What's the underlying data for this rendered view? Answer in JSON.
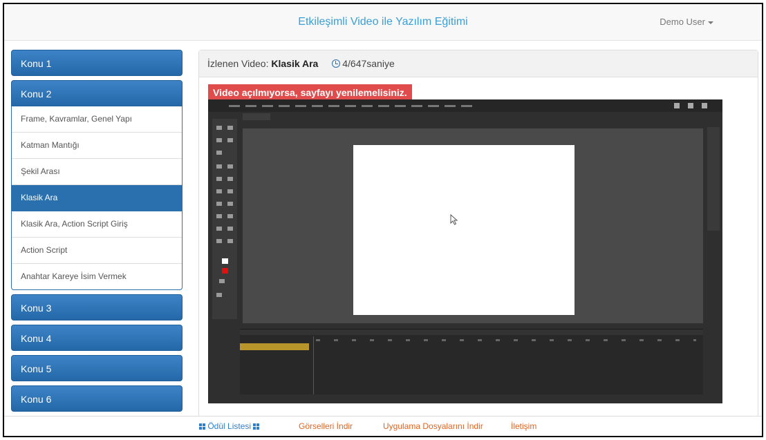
{
  "navbar": {
    "brand": "Etkileşimli Video ile Yazılım Eğitimi",
    "user": "Demo User"
  },
  "sidebar": {
    "topic1": "Konu 1",
    "topic2": "Konu 2",
    "topic2_items": [
      "Frame, Kavramlar, Genel Yapı",
      "Katman Mantığı",
      "Şekil Arası",
      "Klasik Ara",
      "Klasik Ara, Action Script Giriş",
      "Action Script",
      "Anahtar Kareye İsim Vermek"
    ],
    "active_item": "Klasik Ara",
    "topic3": "Konu 3",
    "topic4": "Konu 4",
    "topic5": "Konu 5",
    "topic6": "Konu 6"
  },
  "panel": {
    "watching_label": "İzlenen Video:",
    "video_title": "Klasik Ara",
    "time": "4/647saniye",
    "warning": "Video açılmıyorsa, sayfayı yenilemelisiniz."
  },
  "footer": {
    "awards": "Ödül Listesi",
    "images": "Görselleri İndir",
    "app_files": "Uygulama Dosyalarını İndir",
    "contact": "İletişim"
  },
  "colors": {
    "accent": "#3a9fd6",
    "topic_bg": "#2a6fae",
    "warning_bg": "#e04b4b",
    "footer_red": "#e2631f"
  }
}
